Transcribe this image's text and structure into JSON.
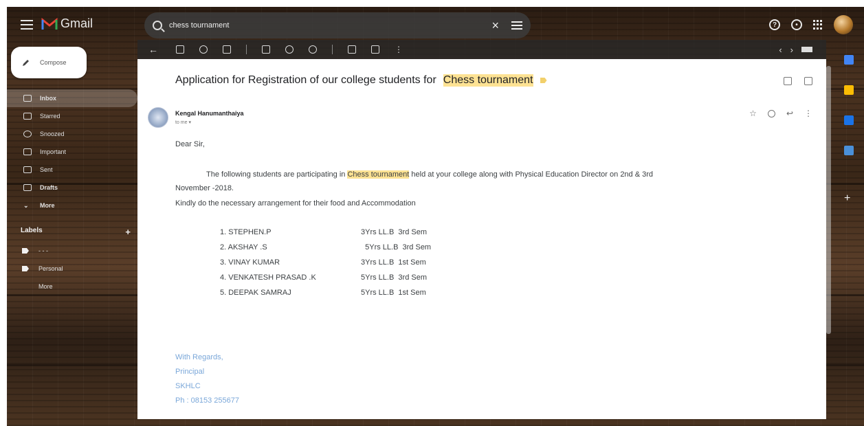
{
  "app": {
    "name": "Gmail"
  },
  "search": {
    "query": "chess tournament",
    "clear_label": "×"
  },
  "sidebar": {
    "compose_label": "Compose",
    "items": [
      {
        "label": "Inbox",
        "count": "",
        "active": true
      },
      {
        "label": "Starred",
        "count": ""
      },
      {
        "label": "Snoozed",
        "count": ""
      },
      {
        "label": "Important",
        "count": ""
      },
      {
        "label": "Sent",
        "count": ""
      },
      {
        "label": "Drafts",
        "count": ""
      },
      {
        "label": "More",
        "count": ""
      }
    ],
    "labels_title": "Labels",
    "labels_add": "+",
    "labels": [
      {
        "label": "- - -"
      },
      {
        "label": "Personal"
      },
      {
        "label": "More"
      }
    ]
  },
  "toolbar": {
    "pager_text": "",
    "prev": "‹",
    "next": "›",
    "more": "⋮"
  },
  "email": {
    "subject_before": "Application for Registration of our college students for",
    "subject_highlight": "Chess tournament",
    "sender_name": "Kengal Hanumanthaiya",
    "sender_email": "",
    "to_me": "to me ▾",
    "date": "",
    "greeting": "Dear Sir,",
    "para1_before": "The following students are participating in",
    "para1_highlight": "Chess tournament",
    "para1_after": "held at your college along with Physical Education Director on 2nd & 3rd",
    "para1_line2": "November -2018.",
    "para2": "Kindly do the necessary arrangement for their food and Accommodation",
    "students": [
      {
        "name": "1. STEPHEN.P",
        "course": "3Yrs LL.B  3rd Sem"
      },
      {
        "name": "2. AKSHAY .S",
        "course": "  5Yrs LL.B  3rd Sem"
      },
      {
        "name": "3. VINAY KUMAR",
        "course": "3Yrs LL.B  1st Sem"
      },
      {
        "name": "4. VENKATESH PRASAD .K",
        "course": "5Yrs LL.B  3rd Sem"
      },
      {
        "name": "5. DEEPAK SAMRAJ",
        "course": "5Yrs LL.B  1st Sem"
      }
    ],
    "signature": [
      "With Regards,",
      "Principal",
      "SKHLC",
      "Ph : 08153 255677"
    ]
  },
  "colors": {
    "highlight": "#fde293",
    "signature": "#7aa7d9",
    "compose_bg": "#ffffff"
  },
  "icons": [
    "hamburger-icon",
    "search-icon",
    "clear-icon",
    "tune-icon",
    "help-icon",
    "settings-icon",
    "apps-icon",
    "pencil-icon",
    "star-icon",
    "reply-icon",
    "print-icon",
    "open-in-new-icon"
  ]
}
